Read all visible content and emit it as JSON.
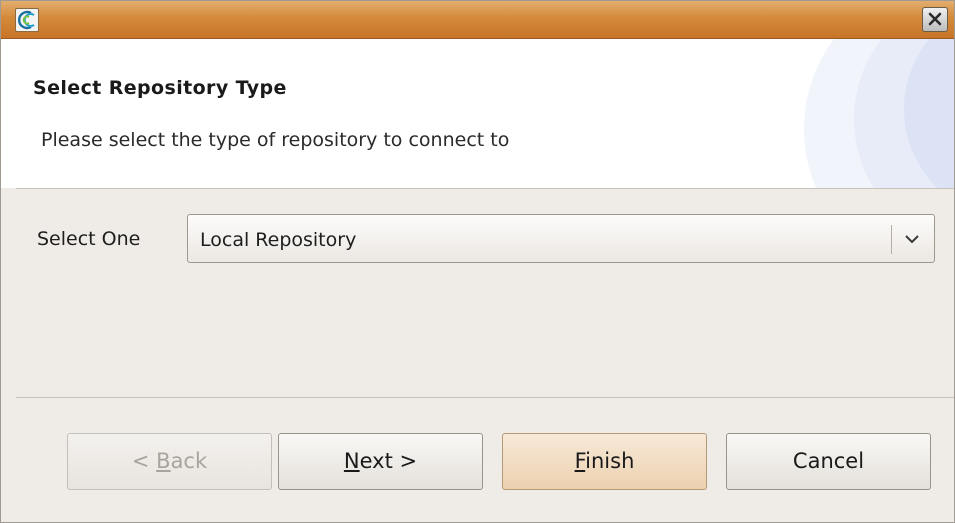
{
  "titlebar": {
    "icon": "app-icon",
    "close_icon": "close-icon"
  },
  "header": {
    "title": "Select Repository Type",
    "description": "Please select the type of repository to connect to"
  },
  "form": {
    "select_label": "Select One",
    "selected_value": "Local Repository",
    "dropdown_icon": "chevron-down-icon"
  },
  "buttons": {
    "back": {
      "mnemonic": "B",
      "prefix": "< ",
      "rest": "ack",
      "enabled": false
    },
    "next": {
      "mnemonic": "N",
      "prefix": "",
      "rest": "ext >",
      "enabled": true
    },
    "finish": {
      "mnemonic": "F",
      "prefix": "",
      "rest": "inish",
      "enabled": true,
      "default": true
    },
    "cancel": {
      "label": "Cancel",
      "enabled": true
    }
  },
  "colors": {
    "titlebar_accent": "#d48a3a",
    "window_bg": "#efebe7",
    "default_button": "#ecd1b0"
  }
}
